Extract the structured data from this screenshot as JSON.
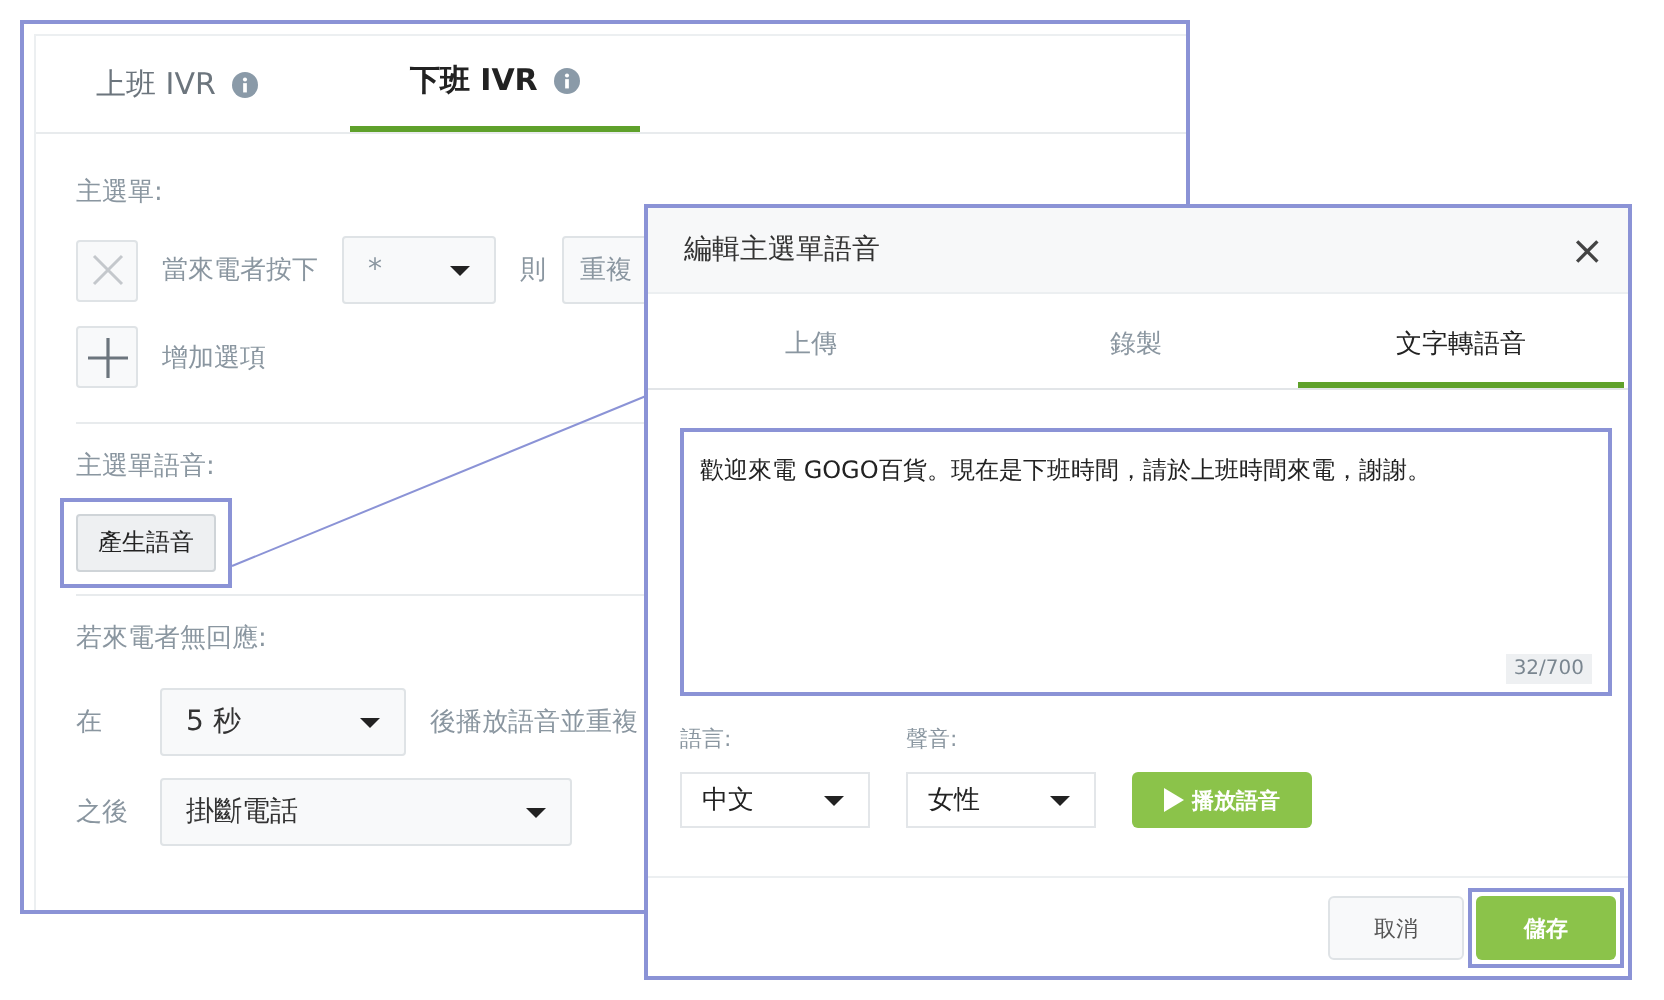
{
  "ivr_panel": {
    "tabs": [
      {
        "label": "上班 IVR",
        "selected": false
      },
      {
        "label": "下班 IVR",
        "selected": true
      }
    ],
    "main_menu_label": "主選單:",
    "option_row": {
      "prefix": "當來電者按下",
      "key_select": "*",
      "then_label": "則",
      "action_select": "重複"
    },
    "add_option": "增加選項",
    "menu_voice_label": "主選單語音:",
    "generate_button": "產生語音",
    "no_response_label": "若來電者無回應:",
    "wait_row": {
      "prefix": "在",
      "select": "5 秒",
      "suffix": "後播放語音並重複"
    },
    "after_row": {
      "prefix": "之後",
      "select": "掛斷電話"
    }
  },
  "dialog": {
    "title": "編輯主選單語音",
    "close": "×",
    "tabs": [
      {
        "label": "上傳",
        "selected": false
      },
      {
        "label": "錄製",
        "selected": false
      },
      {
        "label": "文字轉語音",
        "selected": true
      }
    ],
    "text": "歡迎來電 GOGO百貨。現在是下班時間，請於上班時間來電，謝謝。",
    "counter": "32/700",
    "language_label": "語言:",
    "language_select": "中文",
    "voice_label": "聲音:",
    "voice_select": "女性",
    "play_button": "播放語音",
    "cancel_button": "取消",
    "save_button": "儲存"
  }
}
